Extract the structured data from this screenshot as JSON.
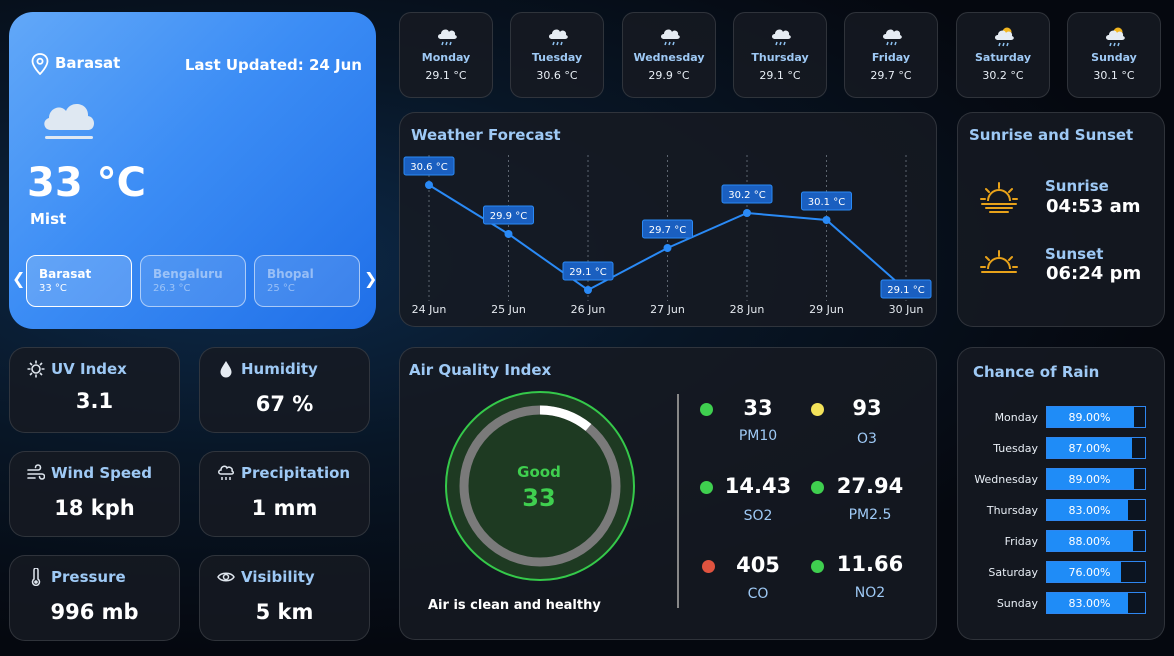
{
  "main": {
    "location": "Barasat",
    "last_updated": "Last Updated: 24 Jun",
    "temperature": "33 °C",
    "condition": "Mist",
    "cities": [
      {
        "name": "Barasat",
        "temp": "33 °C"
      },
      {
        "name": "Bengaluru",
        "temp": "26.3 °C"
      },
      {
        "name": "Bhopal",
        "temp": "25 °C"
      }
    ]
  },
  "week": [
    {
      "day": "Monday",
      "temp": "29.1 °C",
      "icon": "cloud-rain-icon"
    },
    {
      "day": "Tuesday",
      "temp": "30.6 °C",
      "icon": "cloud-rain-icon"
    },
    {
      "day": "Wednesday",
      "temp": "29.9 °C",
      "icon": "cloud-rain-icon"
    },
    {
      "day": "Thursday",
      "temp": "29.1 °C",
      "icon": "cloud-rain-icon"
    },
    {
      "day": "Friday",
      "temp": "29.7 °C",
      "icon": "cloud-rain-icon"
    },
    {
      "day": "Saturday",
      "temp": "30.2 °C",
      "icon": "sun-cloud-rain-icon"
    },
    {
      "day": "Sunday",
      "temp": "30.1 °C",
      "icon": "sun-cloud-rain-icon"
    }
  ],
  "forecast": {
    "title": "Weather Forecast"
  },
  "chart_data": {
    "type": "line",
    "x": [
      "24 Jun",
      "25 Jun",
      "26 Jun",
      "27 Jun",
      "28 Jun",
      "29 Jun",
      "30 Jun"
    ],
    "values": [
      30.6,
      29.9,
      29.1,
      29.7,
      30.2,
      30.1,
      29.1
    ],
    "labels": [
      "30.6 °C",
      "29.9 °C",
      "29.1 °C",
      "29.7 °C",
      "30.2 °C",
      "30.1 °C",
      "29.1 °C"
    ],
    "ylim": [
      29.1,
      30.6
    ],
    "grid": "vertical dashed",
    "color": "#2a8af6"
  },
  "sun": {
    "title": "Sunrise and Sunset",
    "sunrise_label": "Sunrise",
    "sunrise_time": "04:53 am",
    "sunset_label": "Sunset",
    "sunset_time": "06:24 pm",
    "icon_color": "#e8a21a"
  },
  "metrics": {
    "uv": {
      "label": "UV Index",
      "value": "3.1"
    },
    "humidity": {
      "label": "Humidity",
      "value": "67 %"
    },
    "wind": {
      "label": "Wind Speed",
      "value": "18 kph"
    },
    "precip": {
      "label": "Precipitation",
      "value": "1 mm"
    },
    "pressure": {
      "label": "Pressure",
      "value": "996 mb"
    },
    "visibility": {
      "label": "Visibility",
      "value": "5 km"
    }
  },
  "aqi": {
    "title": "Air Quality Index",
    "status": "Good",
    "value": "33",
    "gauge_fraction": 0.11,
    "message": "Air is clean and healthy",
    "pollutants": [
      {
        "name": "PM10",
        "value": "33",
        "color": "#3fcf4f"
      },
      {
        "name": "O3",
        "value": "93",
        "color": "#f3e25a"
      },
      {
        "name": "SO2",
        "value": "14.43",
        "color": "#3fcf4f"
      },
      {
        "name": "PM2.5",
        "value": "27.94",
        "color": "#3fcf4f"
      },
      {
        "name": "CO",
        "value": "405",
        "color": "#e0533f"
      },
      {
        "name": "NO2",
        "value": "11.66",
        "color": "#3fcf4f"
      }
    ]
  },
  "rain": {
    "title": "Chance of Rain",
    "days": [
      {
        "day": "Monday",
        "label": "89.00%",
        "value": 0.89
      },
      {
        "day": "Tuesday",
        "label": "87.00%",
        "value": 0.87
      },
      {
        "day": "Wednesday",
        "label": "89.00%",
        "value": 0.89
      },
      {
        "day": "Thursday",
        "label": "83.00%",
        "value": 0.83
      },
      {
        "day": "Friday",
        "label": "88.00%",
        "value": 0.88
      },
      {
        "day": "Saturday",
        "label": "76.00%",
        "value": 0.76
      },
      {
        "day": "Sunday",
        "label": "83.00%",
        "value": 0.83
      }
    ]
  }
}
